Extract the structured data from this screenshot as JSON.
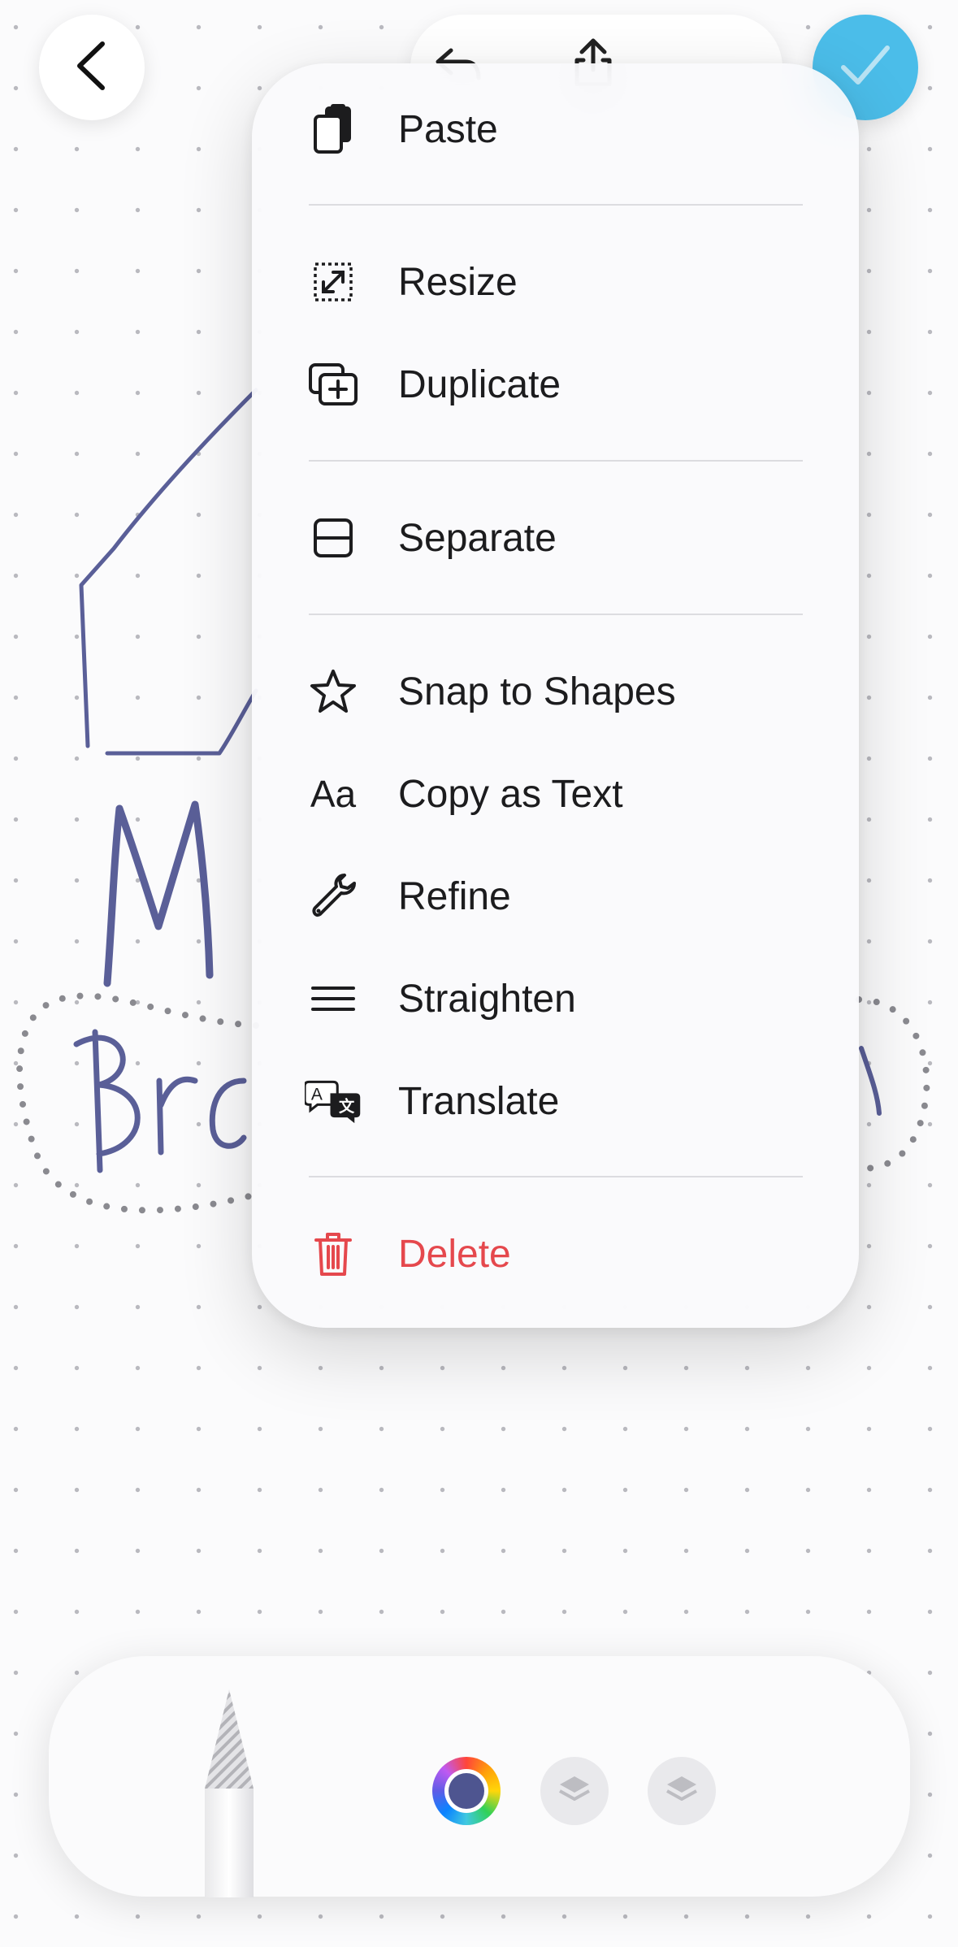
{
  "top_bar": {
    "back_icon": "chevron-left-icon",
    "undo_icon": "undo-icon",
    "share_icon": "share-icon",
    "done_icon": "checkmark-icon",
    "done_color": "#4bbde9"
  },
  "canvas": {
    "ink_color": "#5a5f98",
    "handwriting": [
      {
        "text": "M"
      },
      {
        "text": "Bro"
      }
    ]
  },
  "menu": {
    "items": [
      {
        "label": "Paste",
        "icon": "paste-icon"
      },
      {
        "label": "Resize",
        "icon": "resize-icon"
      },
      {
        "label": "Duplicate",
        "icon": "duplicate-icon"
      },
      {
        "label": "Separate",
        "icon": "separate-icon"
      },
      {
        "label": "Snap to Shapes",
        "icon": "star-icon"
      },
      {
        "label": "Copy as Text",
        "icon": "text-aa-icon",
        "icon_text": "Aa"
      },
      {
        "label": "Refine",
        "icon": "wrench-icon"
      },
      {
        "label": "Straighten",
        "icon": "lines-icon"
      },
      {
        "label": "Translate",
        "icon": "translate-icon"
      },
      {
        "label": "Delete",
        "icon": "trash-icon",
        "color": "#e5484d"
      }
    ]
  },
  "toolbar": {
    "tool": "pencil-icon",
    "color_wheel_icon": "color-wheel-icon",
    "selected_color": "#4e5590",
    "layer_buttons": [
      "layers-icon",
      "layers-icon"
    ]
  }
}
